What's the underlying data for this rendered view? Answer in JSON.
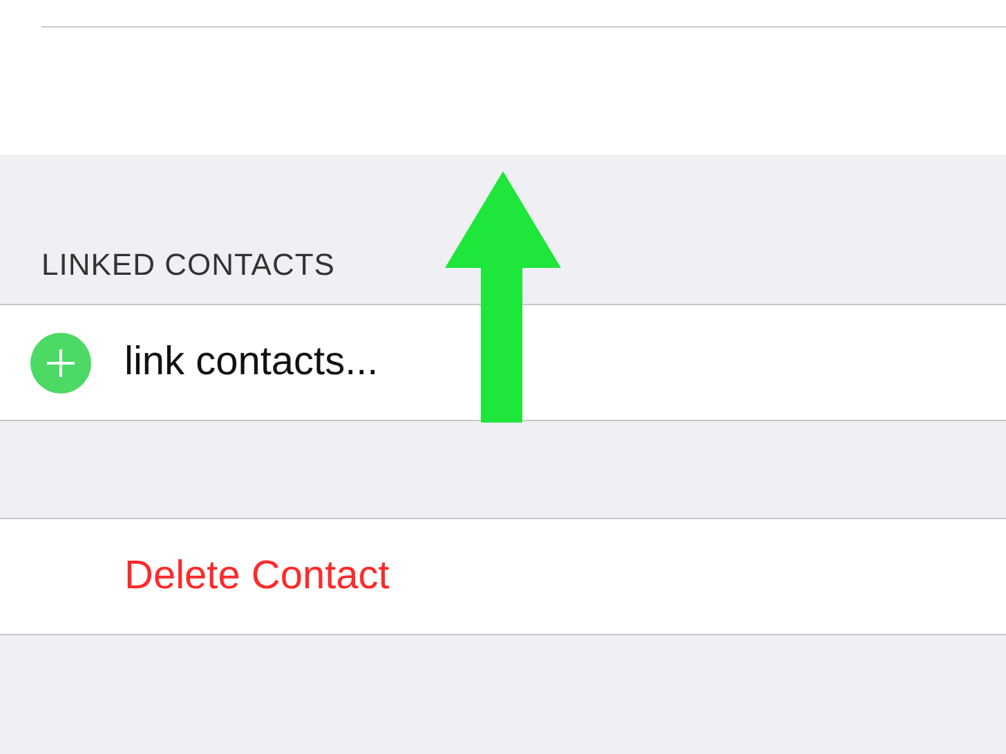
{
  "linked_contacts": {
    "header": "LINKED CONTACTS",
    "rows": [
      {
        "kind": "add",
        "label": "link contacts..."
      }
    ]
  },
  "actions": [
    {
      "kind": "destructive",
      "label": "Delete Contact"
    }
  ],
  "annotation": {
    "kind": "up-arrow"
  }
}
